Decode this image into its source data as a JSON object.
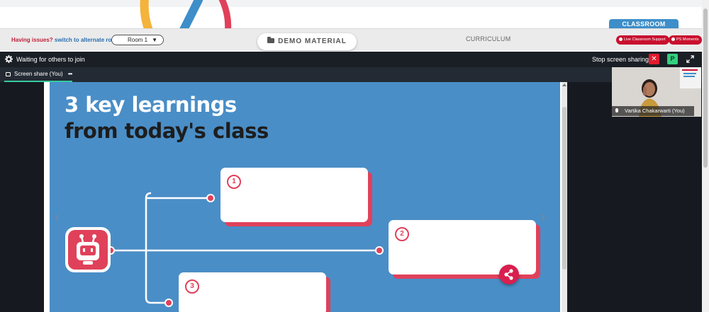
{
  "header": {
    "classroom_tab": "CLASSROOM"
  },
  "navbar": {
    "issues_text": "Having issues?",
    "alt_room_link": "switch to alternate room",
    "room_select_value": "Room 1",
    "demo_material_label": "DEMO MATERIAL",
    "curriculum_label": "CURRICULUM",
    "live_support_label": "Live Classroom Support",
    "ps_moments_label": "PS Moments"
  },
  "meeting": {
    "waiting_text": "Waiting for others to join",
    "stop_sharing_label": "Stop screen sharing",
    "close_label": "✕",
    "p_label": "P"
  },
  "tabs": {
    "active_label": "Screen share (You)",
    "more_label": "•••"
  },
  "slide": {
    "title_line1": "3 key learnings",
    "title_line2": "from today's class",
    "cards": [
      "1",
      "2",
      "3"
    ],
    "prev_arrow": "‹",
    "next_arrow": "›"
  },
  "video": {
    "participant_name": "Vartika Chakarwarti (You)"
  },
  "colors": {
    "slide_bg": "#4a8ec7",
    "accent_red": "#e0415a",
    "brand_blue": "#3d8ec9",
    "dark_bar": "#1a1f26",
    "green_ok": "#35d07f"
  }
}
